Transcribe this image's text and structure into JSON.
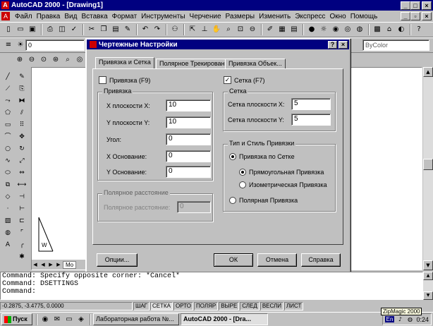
{
  "window": {
    "title": "AutoCAD 2000 - [Drawing1]",
    "min": "_",
    "max": "□",
    "close": "×"
  },
  "menu": [
    "Файл",
    "Правка",
    "Вид",
    "Вставка",
    "Формат",
    "Инструменты",
    "Черчение",
    "Размеры",
    "Изменить",
    "Экспресс",
    "Окно",
    "Помощь"
  ],
  "doc_controls": {
    "min": "_",
    "restore": "▫",
    "close": "×"
  },
  "layer_combo": {
    "value": "0",
    "color_value": "ByColor"
  },
  "dialog": {
    "title": "Чертежные Настройки",
    "help": "?",
    "close": "×",
    "tabs": [
      "Привязка и Сетка",
      "Полярное Трекирование",
      "Привязка Объек..."
    ],
    "snap_on_label": "Привязка (F9)",
    "snap_on_checked": false,
    "grid_on_label": "Сетка (F7)",
    "grid_on_checked": true,
    "snap_group": {
      "title": "Привязка",
      "x_spacing_label": "X плоскости X:",
      "x_spacing_value": "10",
      "y_spacing_label": "Y плоскости Y:",
      "y_spacing_value": "10",
      "angle_label": "Угол:",
      "angle_value": "0",
      "x_base_label": "X Основание:",
      "x_base_value": "0",
      "y_base_label": "Y Основание:",
      "y_base_value": "0"
    },
    "polar_group": {
      "title": "Полярное расстояние",
      "distance_label": "Полярное расстояние:",
      "distance_value": "0"
    },
    "grid_group": {
      "title": "Сетка",
      "x_spacing_label": "Сетка плоскости X:",
      "x_spacing_value": "5",
      "y_spacing_label": "Сетка плоскости Y:",
      "y_spacing_value": "5"
    },
    "snap_type_group": {
      "title": "Тип и Стиль Привязки",
      "grid_snap_label": "Привязка по Сетке",
      "grid_snap_selected": true,
      "rectangular_label": "Прямоугольная Привязка",
      "rectangular_selected": true,
      "isometric_label": "Изометрическая Привязка",
      "isometric_selected": false,
      "polar_snap_label": "Полярная Привязка",
      "polar_snap_selected": false
    },
    "buttons": {
      "options": "Опции...",
      "ok": "ОК",
      "cancel": "Отмена",
      "help": "Справка"
    }
  },
  "command_lines": [
    "Command:  Specify opposite corner: *Cancel*",
    "Command:  DSETTINGS",
    "Command:"
  ],
  "status": {
    "coords": "-0.2875, -3.4775, 0.0000",
    "toggles": [
      "ШАГ",
      "СЕТКА",
      "ОРТО",
      "ПОЛЯР",
      "ВЫРЕ",
      "СЛЕД",
      "ВЕСЛИ",
      "ЛИСТ"
    ]
  },
  "taskbar": {
    "start": "Пуск",
    "tasks": [
      "Лабораторная работа №...",
      "AutoCAD 2000 - [Dra..."
    ],
    "tray_lang": "En",
    "clock": "0:24",
    "tooltip": "ZipMagic 2000"
  },
  "layout_tab": "Mo"
}
